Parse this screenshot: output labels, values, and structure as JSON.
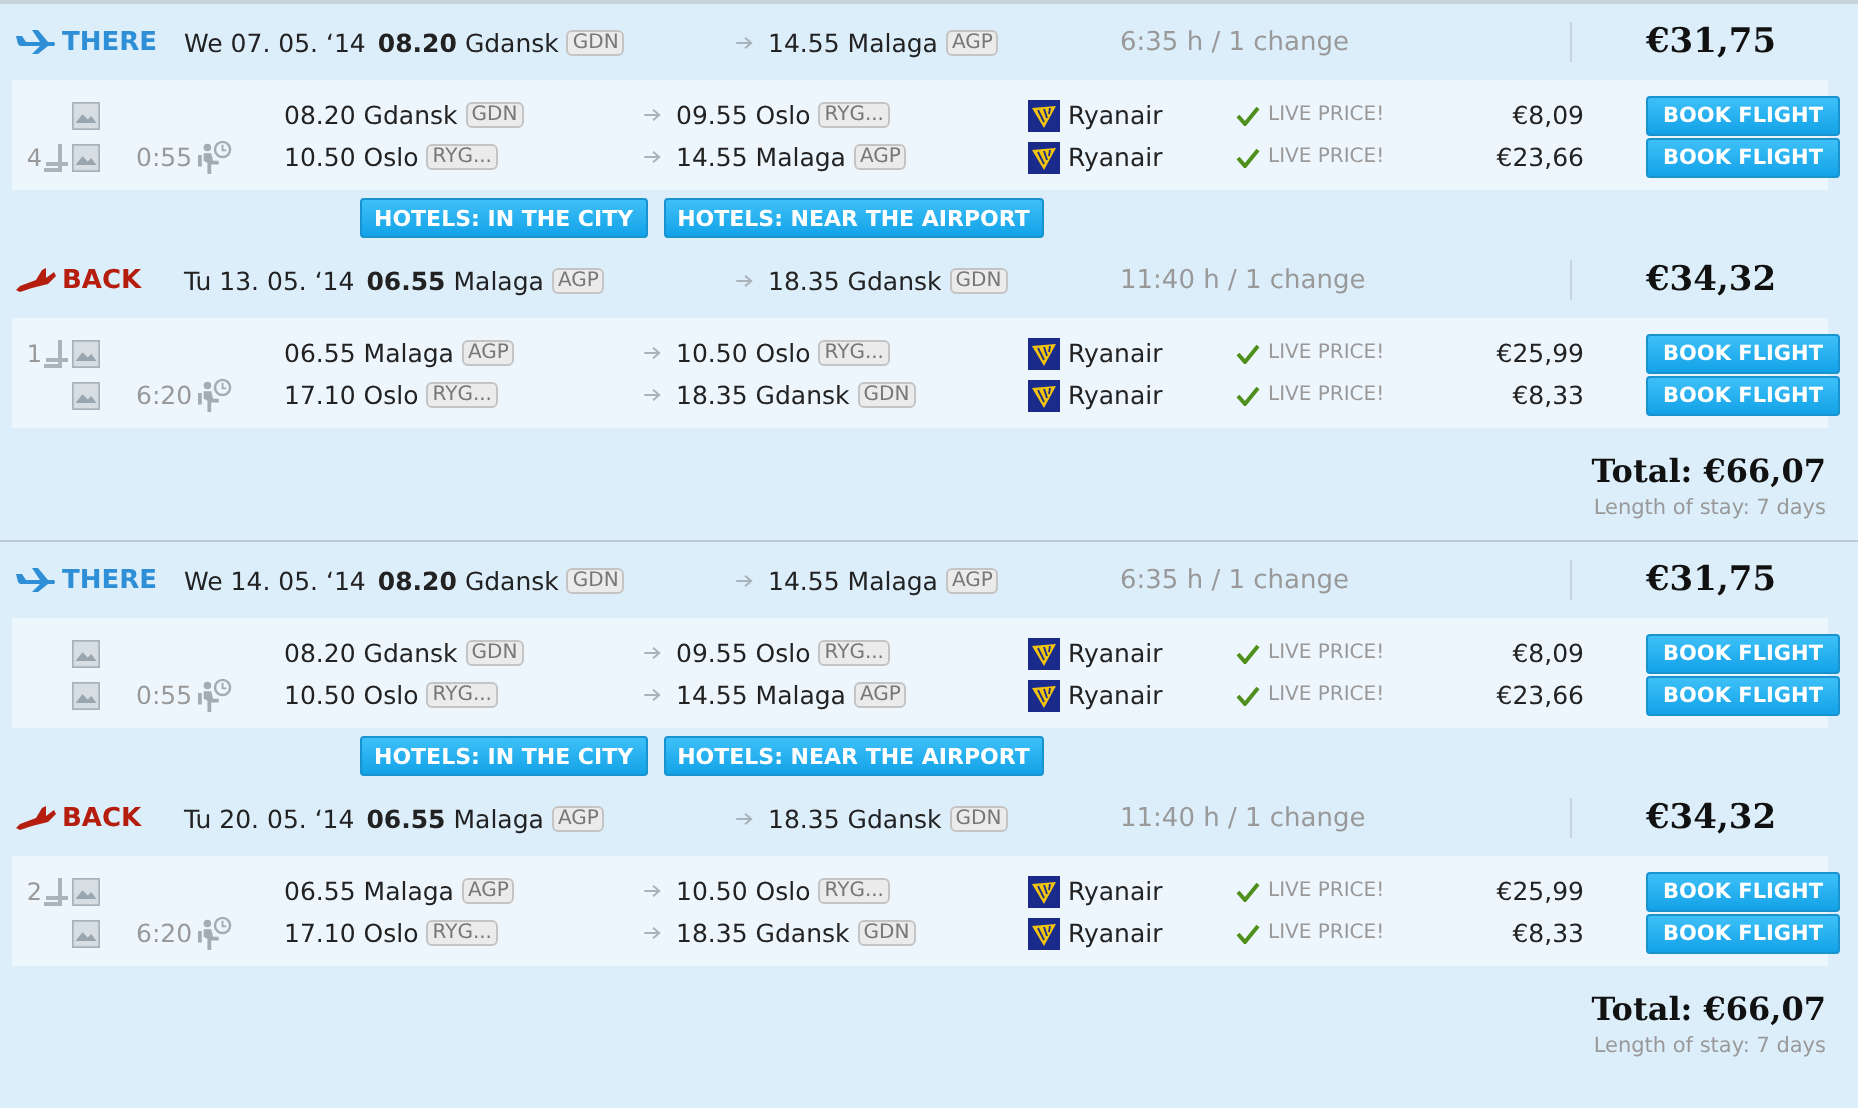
{
  "results": [
    {
      "legs": [
        {
          "kind": "there",
          "label": "THERE",
          "date": "We 07. 05. ‘14",
          "dep_time": "08.20",
          "dep_city": "Gdansk",
          "dep_code": "GDN",
          "arr_time": "14.55",
          "arr_city": "Malaga",
          "arr_code": "AGP",
          "duration": "6:35 h / 1 change",
          "price": "€31,75",
          "layover": "0:55",
          "segments": [
            {
              "dep_time": "08.20",
              "dep_city": "Gdansk",
              "dep_code": "GDN",
              "arr_time": "09.55",
              "arr_city": "Oslo",
              "arr_code": "RYG...",
              "airline": "Ryanair",
              "live": "LIVE PRICE!",
              "price": "€8,09",
              "button": "BOOK FLIGHT"
            },
            {
              "seats": "4",
              "dep_time": "10.50",
              "dep_city": "Oslo",
              "dep_code": "RYG...",
              "arr_time": "14.55",
              "arr_city": "Malaga",
              "arr_code": "AGP",
              "airline": "Ryanair",
              "live": "LIVE PRICE!",
              "price": "€23,66",
              "button": "BOOK FLIGHT"
            }
          ]
        },
        {
          "kind": "back",
          "label": "BACK",
          "date": "Tu 13. 05. ‘14",
          "dep_time": "06.55",
          "dep_city": "Malaga",
          "dep_code": "AGP",
          "arr_time": "18.35",
          "arr_city": "Gdansk",
          "arr_code": "GDN",
          "duration": "11:40 h / 1 change",
          "price": "€34,32",
          "layover": "6:20",
          "segments": [
            {
              "seats": "1",
              "dep_time": "06.55",
              "dep_city": "Malaga",
              "dep_code": "AGP",
              "arr_time": "10.50",
              "arr_city": "Oslo",
              "arr_code": "RYG...",
              "airline": "Ryanair",
              "live": "LIVE PRICE!",
              "price": "€25,99",
              "button": "BOOK FLIGHT"
            },
            {
              "dep_time": "17.10",
              "dep_city": "Oslo",
              "dep_code": "RYG...",
              "arr_time": "18.35",
              "arr_city": "Gdansk",
              "arr_code": "GDN",
              "airline": "Ryanair",
              "live": "LIVE PRICE!",
              "price": "€8,33",
              "button": "BOOK FLIGHT"
            }
          ]
        }
      ],
      "hotel_buttons": [
        "HOTELS: IN THE CITY",
        "HOTELS: NEAR THE AIRPORT"
      ],
      "total": "Total: €66,07",
      "stay": "Length of stay: 7 days"
    },
    {
      "legs": [
        {
          "kind": "there",
          "label": "THERE",
          "date": "We 14. 05. ‘14",
          "dep_time": "08.20",
          "dep_city": "Gdansk",
          "dep_code": "GDN",
          "arr_time": "14.55",
          "arr_city": "Malaga",
          "arr_code": "AGP",
          "duration": "6:35 h / 1 change",
          "price": "€31,75",
          "layover": "0:55",
          "segments": [
            {
              "dep_time": "08.20",
              "dep_city": "Gdansk",
              "dep_code": "GDN",
              "arr_time": "09.55",
              "arr_city": "Oslo",
              "arr_code": "RYG...",
              "airline": "Ryanair",
              "live": "LIVE PRICE!",
              "price": "€8,09",
              "button": "BOOK FLIGHT"
            },
            {
              "dep_time": "10.50",
              "dep_city": "Oslo",
              "dep_code": "RYG...",
              "arr_time": "14.55",
              "arr_city": "Malaga",
              "arr_code": "AGP",
              "airline": "Ryanair",
              "live": "LIVE PRICE!",
              "price": "€23,66",
              "button": "BOOK FLIGHT"
            }
          ]
        },
        {
          "kind": "back",
          "label": "BACK",
          "date": "Tu 20. 05. ‘14",
          "dep_time": "06.55",
          "dep_city": "Malaga",
          "dep_code": "AGP",
          "arr_time": "18.35",
          "arr_city": "Gdansk",
          "arr_code": "GDN",
          "duration": "11:40 h / 1 change",
          "price": "€34,32",
          "layover": "6:20",
          "segments": [
            {
              "seats": "2",
              "dep_time": "06.55",
              "dep_city": "Malaga",
              "dep_code": "AGP",
              "arr_time": "10.50",
              "arr_city": "Oslo",
              "arr_code": "RYG...",
              "airline": "Ryanair",
              "live": "LIVE PRICE!",
              "price": "€25,99",
              "button": "BOOK FLIGHT"
            },
            {
              "dep_time": "17.10",
              "dep_city": "Oslo",
              "dep_code": "RYG...",
              "arr_time": "18.35",
              "arr_city": "Gdansk",
              "arr_code": "GDN",
              "airline": "Ryanair",
              "live": "LIVE PRICE!",
              "price": "€8,33",
              "button": "BOOK FLIGHT"
            }
          ]
        }
      ],
      "hotel_buttons": [
        "HOTELS: IN THE CITY",
        "HOTELS: NEAR THE AIRPORT"
      ],
      "total": "Total: €66,07",
      "stay": "Length of stay: 7 days"
    }
  ]
}
